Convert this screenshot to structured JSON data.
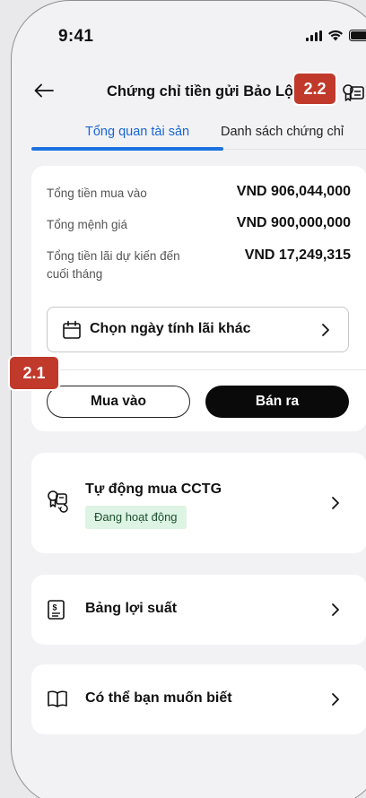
{
  "status_bar": {
    "time": "9:41"
  },
  "header": {
    "title": "Chứng chỉ tiền gửi Bảo Lộc"
  },
  "tabs": [
    {
      "label": "Tổng quan tài sản",
      "active": true
    },
    {
      "label": "Danh sách chứng chỉ",
      "active": false
    }
  ],
  "summary": {
    "rows": [
      {
        "label": "Tổng tiền mua vào",
        "value": "VND 906,044,000"
      },
      {
        "label": "Tổng mệnh giá",
        "value": "VND 900,000,000"
      },
      {
        "label": "Tổng tiền lãi dự kiến đến cuối tháng",
        "value": "VND 17,249,315"
      }
    ],
    "date_button_label": "Chọn ngày tính lãi khác",
    "buy_label": "Mua vào",
    "sell_label": "Bán ra"
  },
  "menu": {
    "auto_buy": {
      "label": "Tự động mua CCTG",
      "status": "Đang hoạt động"
    },
    "rates": {
      "label": "Bảng lợi suất"
    },
    "info": {
      "label": "Có thể bạn muốn biết"
    }
  },
  "annotations": {
    "marker_1": "2.1",
    "marker_2": "2.2"
  },
  "colors": {
    "accent": "#1c72e0",
    "status_badge_bg": "#ddf3e3",
    "marker": "#c0392b"
  },
  "icons": [
    "back-arrow-icon",
    "certificate-icon",
    "calendar-icon",
    "chevron-right-icon",
    "auto-buy-icon",
    "rates-doc-icon",
    "book-icon",
    "signal-icon",
    "wifi-icon",
    "battery-icon"
  ]
}
